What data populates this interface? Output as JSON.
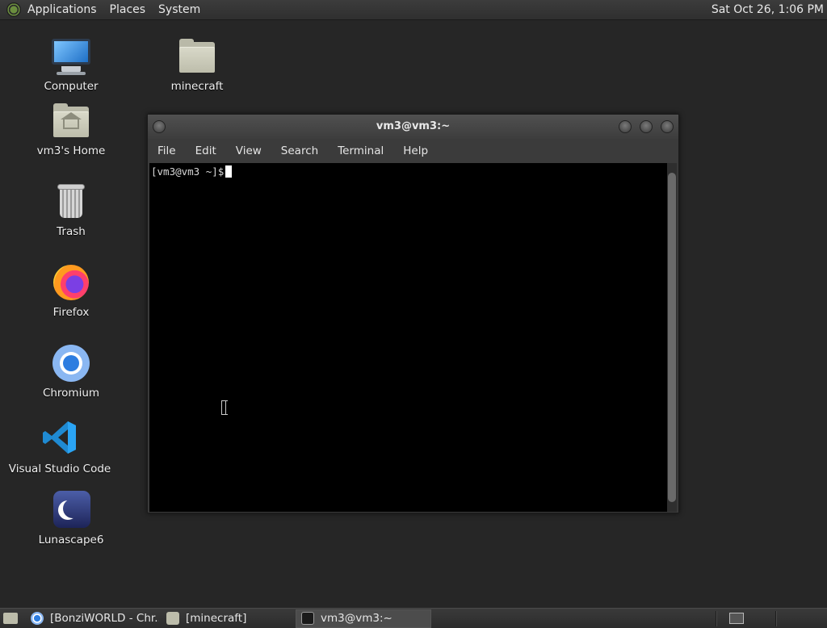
{
  "top_panel": {
    "menus": [
      "Applications",
      "Places",
      "System"
    ],
    "clock": "Sat Oct 26,  1:06 PM"
  },
  "desktop": {
    "icons": [
      {
        "label": "Computer",
        "icon": "computer-icon"
      },
      {
        "label": "minecraft",
        "icon": "folder-icon"
      },
      {
        "label": "vm3's Home",
        "icon": "home-folder-icon"
      },
      {
        "label": "Trash",
        "icon": "trash-icon"
      },
      {
        "label": "Firefox",
        "icon": "firefox-icon"
      },
      {
        "label": "Chromium",
        "icon": "chromium-icon"
      },
      {
        "label": "Visual Studio Code",
        "icon": "vscode-icon"
      },
      {
        "label": "Lunascape6",
        "icon": "lunascape-icon"
      }
    ]
  },
  "terminal": {
    "title": "vm3@vm3:~",
    "menus": [
      "File",
      "Edit",
      "View",
      "Search",
      "Terminal",
      "Help"
    ],
    "prompt": "[vm3@vm3 ~]$"
  },
  "taskbar": {
    "tasks": [
      {
        "label": "[BonziWORLD - Chr...",
        "icon": "chromium-icon",
        "active": false
      },
      {
        "label": "[minecraft]",
        "icon": "folder-icon",
        "active": false
      },
      {
        "label": "vm3@vm3:~",
        "icon": "terminal-icon",
        "active": true
      }
    ]
  },
  "colors": {
    "desktop_bg": "#262626",
    "panel_bg": "#333333",
    "terminal_bg": "#000000"
  }
}
